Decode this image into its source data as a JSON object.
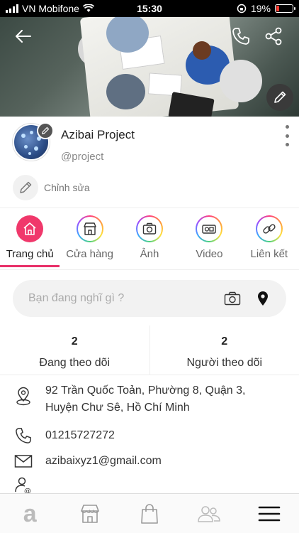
{
  "status_bar": {
    "carrier": "VN Mobifone",
    "time": "15:30",
    "battery_text": "19%",
    "battery_level": 0.19
  },
  "cover": {
    "icons": [
      "back-arrow-icon",
      "phone-icon",
      "share-icon",
      "pencil-icon"
    ]
  },
  "profile": {
    "name": "Azibai Project",
    "handle": "@project",
    "edit_label": "Chỉnh sửa"
  },
  "tabs": [
    {
      "label": "Trang chủ",
      "icon": "home-icon",
      "active": true
    },
    {
      "label": "Cửa hàng",
      "icon": "store-icon",
      "active": false
    },
    {
      "label": "Ảnh",
      "icon": "camera-icon",
      "active": false
    },
    {
      "label": "Video",
      "icon": "video-icon",
      "active": false
    },
    {
      "label": "Liên kết",
      "icon": "link-icon",
      "active": false
    }
  ],
  "post": {
    "placeholder": "Bạn đang nghĩ gì ?"
  },
  "follow": {
    "following_count": "2",
    "following_label": "Đang theo dõi",
    "followers_count": "2",
    "followers_label": "Người theo dõi"
  },
  "info": {
    "address_line1": "92 Trần Quốc Toản, Phường 8, Quận 3,",
    "address_line2": "Huyện Chư Sê, Hồ Chí Minh",
    "phone": "01215727272",
    "email": "azibaixyz1@gmail.com"
  },
  "bottom_nav": {
    "logo_letter": "a",
    "items": [
      "azibai-logo-icon",
      "store-icon",
      "shopping-bag-icon",
      "people-icon",
      "menu-icon"
    ]
  },
  "colors": {
    "accent": "#e83069",
    "active_tab": "#f0386b"
  }
}
